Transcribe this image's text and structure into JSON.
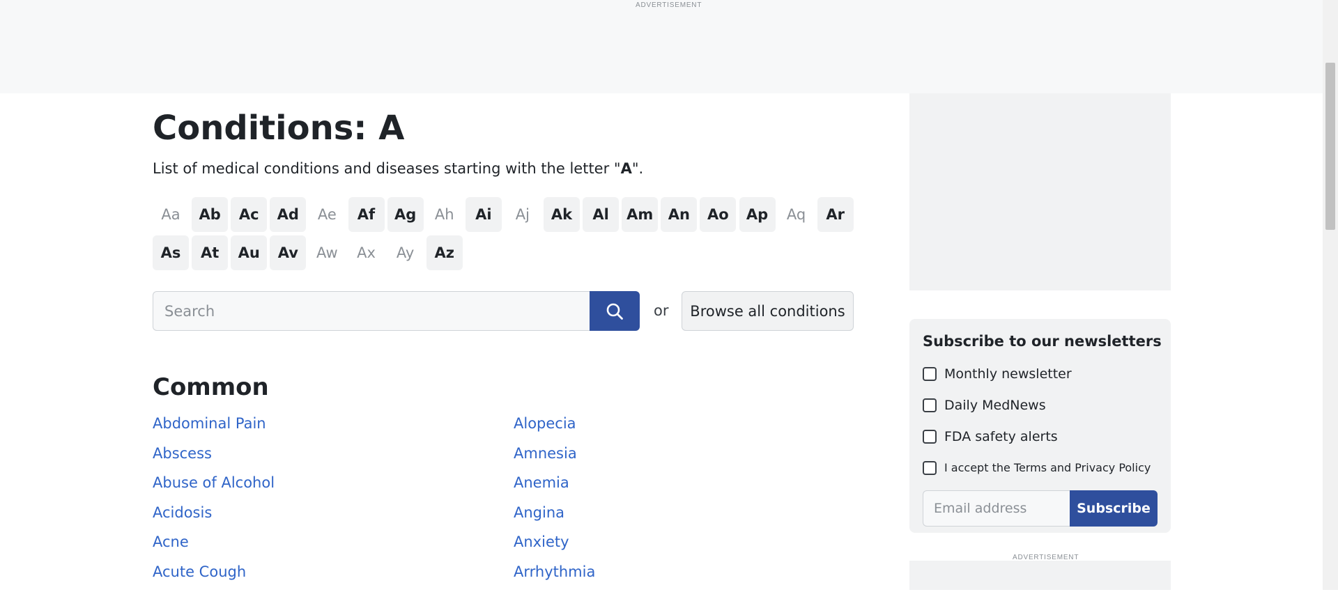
{
  "top_ad": {
    "label": "ADVERTISEMENT"
  },
  "page": {
    "title": "Conditions: A",
    "subtitle_prefix": "List of medical conditions and diseases starting with the letter \"",
    "subtitle_letter": "A",
    "subtitle_suffix": "\"."
  },
  "letters": [
    {
      "label": "Aa",
      "active": false
    },
    {
      "label": "Ab",
      "active": true
    },
    {
      "label": "Ac",
      "active": true
    },
    {
      "label": "Ad",
      "active": true
    },
    {
      "label": "Ae",
      "active": false
    },
    {
      "label": "Af",
      "active": true
    },
    {
      "label": "Ag",
      "active": true
    },
    {
      "label": "Ah",
      "active": false
    },
    {
      "label": "Ai",
      "active": true
    },
    {
      "label": "Aj",
      "active": false
    },
    {
      "label": "Ak",
      "active": true
    },
    {
      "label": "Al",
      "active": true
    },
    {
      "label": "Am",
      "active": true
    },
    {
      "label": "An",
      "active": true
    },
    {
      "label": "Ao",
      "active": true
    },
    {
      "label": "Ap",
      "active": true
    },
    {
      "label": "Aq",
      "active": false
    },
    {
      "label": "Ar",
      "active": true
    },
    {
      "label": "As",
      "active": true
    },
    {
      "label": "At",
      "active": true
    },
    {
      "label": "Au",
      "active": true
    },
    {
      "label": "Av",
      "active": true
    },
    {
      "label": "Aw",
      "active": false
    },
    {
      "label": "Ax",
      "active": false
    },
    {
      "label": "Ay",
      "active": false
    },
    {
      "label": "Az",
      "active": true
    }
  ],
  "search": {
    "placeholder": "Search",
    "button_icon": "search-icon",
    "or_label": "or",
    "browse_label": "Browse all conditions"
  },
  "common": {
    "heading": "Common",
    "column1": [
      "Abdominal Pain",
      "Abscess",
      "Abuse of Alcohol",
      "Acidosis",
      "Acne",
      "Acute Cough"
    ],
    "column2": [
      "Alopecia",
      "Amnesia",
      "Anemia",
      "Angina",
      "Anxiety",
      "Arrhythmia"
    ]
  },
  "newsletter": {
    "title": "Subscribe to our newsletters",
    "options": [
      "Monthly newsletter",
      "Daily MedNews",
      "FDA safety alerts"
    ],
    "terms": "I accept the Terms and Privacy Policy",
    "email_placeholder": "Email address",
    "subscribe_label": "Subscribe"
  },
  "sidebar_ad": {
    "label": "ADVERTISEMENT"
  },
  "colors": {
    "primary_button": "#2f4f9d",
    "link": "#2f64c8",
    "ad_background": "#f1f2f3"
  }
}
